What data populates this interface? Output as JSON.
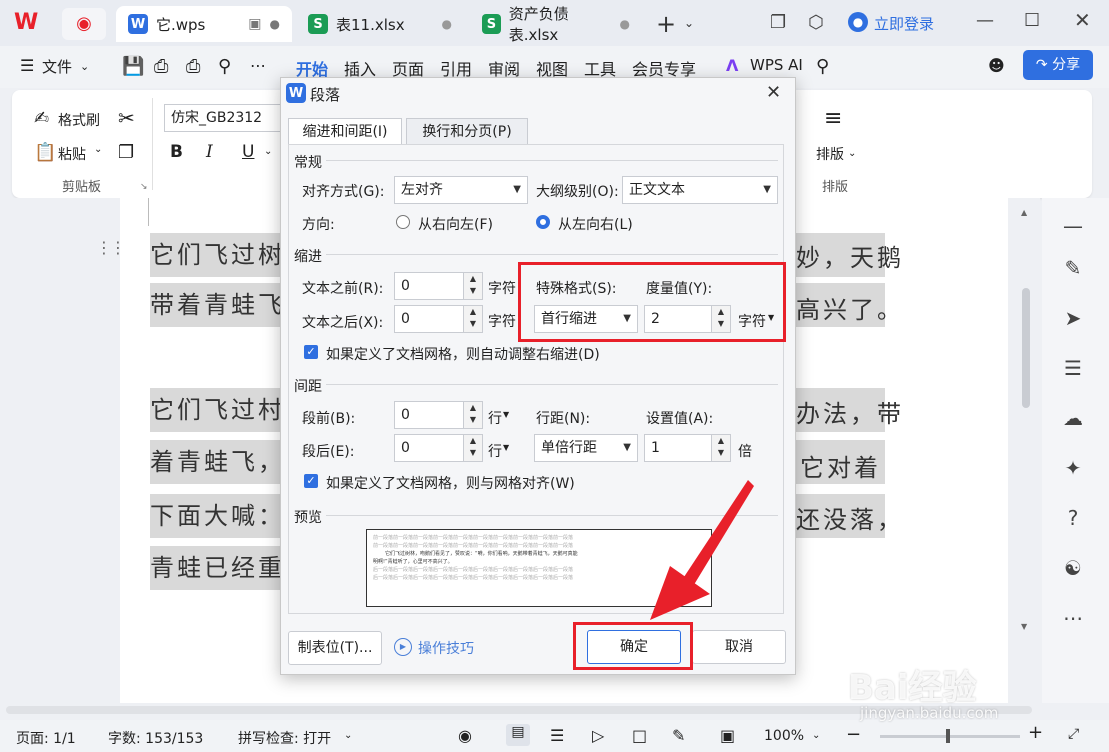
{
  "titlebar": {
    "tabs": [
      {
        "label": "它.wps",
        "badge": "W",
        "badge_color": "#2f6fe0"
      },
      {
        "label": "表11.xlsx",
        "badge": "S",
        "badge_color": "#1b9c55"
      },
      {
        "label": "资产负债表.xlsx",
        "badge": "S",
        "badge_color": "#1b9c55"
      }
    ],
    "login_label": "立即登录"
  },
  "menubar": {
    "file_label": "文件",
    "items": [
      "开始",
      "插入",
      "页面",
      "引用",
      "审阅",
      "视图",
      "工具",
      "会员专享"
    ],
    "ai_label": "WPS AI",
    "share_label": "分享"
  },
  "ribbon": {
    "format_brush": "格式刷",
    "paste": "粘贴",
    "clipboard_group": "剪贴板",
    "font_name": "仿宋_GB2312",
    "bold": "B",
    "italic": "I",
    "underline": "U",
    "arrange": "排版",
    "arrange_group": "排版"
  },
  "document": {
    "lines": [
      "它们飞过树林，",
      "带着青蛙飞，",
      "它们飞过村庄，",
      "着青蛙飞，",
      "下面大喊：",
      "青蛙已经重"
    ],
    "right_fragments": [
      "妙，天鹅",
      "高兴了。",
      "办法，带",
      "它对着",
      "还没落，"
    ]
  },
  "dialog": {
    "title": "段落",
    "tabs": [
      "缩进和间距(I)",
      "换行和分页(P)"
    ],
    "general": {
      "section": "常规",
      "align_label": "对齐方式(G):",
      "align_value": "左对齐",
      "outline_label": "大纲级别(O):",
      "outline_value": "正文文本",
      "direction_label": "方向:",
      "rtl_label": "从右向左(F)",
      "ltr_label": "从左向右(L)"
    },
    "indent": {
      "section": "缩进",
      "before_label": "文本之前(R):",
      "before_value": "0",
      "after_label": "文本之后(X):",
      "after_value": "0",
      "unit": "字符",
      "special_label": "特殊格式(S):",
      "special_value": "首行缩进",
      "measure_label": "度量值(Y):",
      "measure_value": "2",
      "measure_unit": "字符",
      "auto_adjust": "如果定义了文档网格，则自动调整右缩进(D)"
    },
    "spacing": {
      "section": "间距",
      "before_label": "段前(B):",
      "before_value": "0",
      "after_label": "段后(E):",
      "after_value": "0",
      "unit": "行",
      "line_label": "行距(N):",
      "line_value": "单倍行距",
      "set_label": "设置值(A):",
      "set_value": "1",
      "set_unit": "倍",
      "grid_align": "如果定义了文档网格，则与网格对齐(W)"
    },
    "preview": {
      "section": "预览",
      "prev_text": "前一段落前一段落前一段落前一段落前一段落前一段落前一段落前一段落前一段落前一段落",
      "body_text": "它们飞过树林，吻鹅们看见了，赞叹说：“嗬，你们看呐，天鹅带着青蛙飞，天鹅可真能",
      "body_text2": "明啊!”青蛙听了，心里可不高兴了。",
      "next_text": "后一段落后一段落后一段落后一段落后一段落后一段落后一段落后一段落后一段落后一段落"
    },
    "buttons": {
      "tabs": "制表位(T)...",
      "tips": "操作技巧",
      "ok": "确定",
      "cancel": "取消"
    }
  },
  "statusbar": {
    "page": "页面: 1/1",
    "words": "字数: 153/153",
    "spell": "拼写检查: 打开",
    "zoom": "100%"
  },
  "watermark": {
    "brand": "Bai经验",
    "url": "jingyan.baidu.com"
  }
}
